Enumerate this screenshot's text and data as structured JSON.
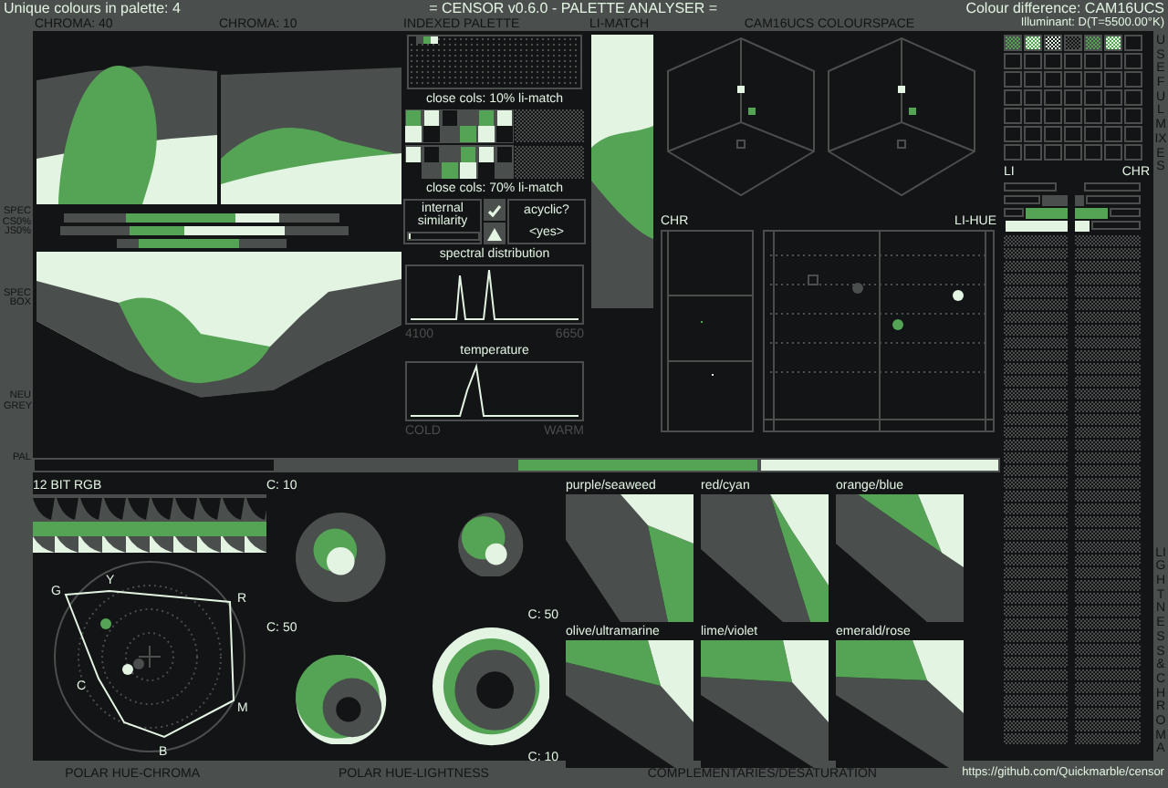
{
  "header": {
    "unique_colours": "Unique colours in palette: 4",
    "title": "= CENSOR v0.6.0 - PALETTE ANALYSER =",
    "colour_difference": "Colour difference: CAM16UCS",
    "illuminant": "Illuminant: D(T=5500.00°K)"
  },
  "palette": [
    {
      "color": "#121416"
    },
    {
      "color": "#4a4e4c"
    },
    {
      "color": "#55a455"
    },
    {
      "color": "#e3f4e3"
    }
  ],
  "panel_titles": {
    "chroma_40": "CHROMA: 40",
    "chroma_10": "CHROMA: 10",
    "indexed_palette": "INDEXED PALETTE",
    "li_match": "LI-MATCH",
    "colourspace": "CAM16UCS COLOURSPACE"
  },
  "side_labels": {
    "spec": "SPEC",
    "cs0": "CS0%",
    "js0": "JS0%",
    "spec_box": "SPEC BOX",
    "neu_grey": "NEU GREY",
    "pal": "PAL"
  },
  "close_cols": [
    "close cols: 10% li-match",
    "close cols: 70% li-match"
  ],
  "internal_similarity": {
    "label": "internal similarity",
    "level": 0.05,
    "checked": true
  },
  "acyclic": {
    "label": "acyclic?",
    "value": "<yes>"
  },
  "spectral": {
    "title": "spectral distribution",
    "min": "4100",
    "max": "6650"
  },
  "temperature": {
    "title": "temperature",
    "min": "COLD",
    "max": "WARM"
  },
  "chr_lihue": {
    "left": "CHR",
    "right": "LI-HUE"
  },
  "rgb12": {
    "title": "12 BIT RGB"
  },
  "polar_hue_chroma": {
    "hue_labels": [
      "G",
      "Y",
      "R",
      "C",
      "M",
      "B"
    ]
  },
  "polar_hue_lightness": [
    {
      "label": "C: 10"
    },
    {
      "label": "C: 50"
    },
    {
      "label": "C: 50"
    },
    {
      "label": "C: 10"
    }
  ],
  "complementaries": [
    {
      "label": "purple/seaweed"
    },
    {
      "label": "red/cyan"
    },
    {
      "label": "orange/blue"
    },
    {
      "label": "olive/ultramarine"
    },
    {
      "label": "lime/violet"
    },
    {
      "label": "emerald/rose"
    }
  ],
  "right_panel": {
    "li": "LI",
    "chr": "CHR",
    "useful_mixes": "USEFUL MIXES",
    "lightness_chroma": "LIGHTNESS & CHROMA"
  },
  "footer": {
    "polar_hue_chroma": "POLAR HUE-CHROMA",
    "polar_hue_lightness": "POLAR HUE-LIGHTNESS",
    "complementaries": "COMPLEMENTARIES/DESATURATION",
    "url": "https://github.com/Quickmarble/censor"
  }
}
